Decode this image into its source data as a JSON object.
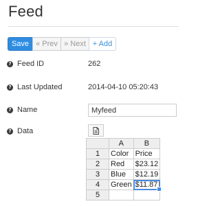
{
  "page": {
    "title": "Feed"
  },
  "toolbar": {
    "save_label": "Save",
    "prev_label": "« Prev",
    "next_label": "» Next",
    "add_label": "+ Add",
    "colors": {
      "primary": "#2f8ce0",
      "link": "#3f8fd6"
    }
  },
  "fields": {
    "feed_id": {
      "label": "Feed ID",
      "value": "262"
    },
    "last_updated": {
      "label": "Last Updated",
      "value": "2014-04-10 05:20:43"
    },
    "name": {
      "label": "Name",
      "value": "Myfeed"
    },
    "data": {
      "label": "Data"
    }
  },
  "icons": {
    "help": "question-circle-icon",
    "document": "document-icon"
  },
  "grid": {
    "columns": [
      "A",
      "B"
    ],
    "rows": [
      {
        "num": "1",
        "a": "Color",
        "b": "Price"
      },
      {
        "num": "2",
        "a": "Red",
        "b": "$23.12"
      },
      {
        "num": "3",
        "a": "Blue",
        "b": "$12.19"
      },
      {
        "num": "4",
        "a": "Green",
        "b": "$11.87"
      },
      {
        "num": "5",
        "a": "",
        "b": ""
      }
    ],
    "selected_cell": "B4"
  }
}
